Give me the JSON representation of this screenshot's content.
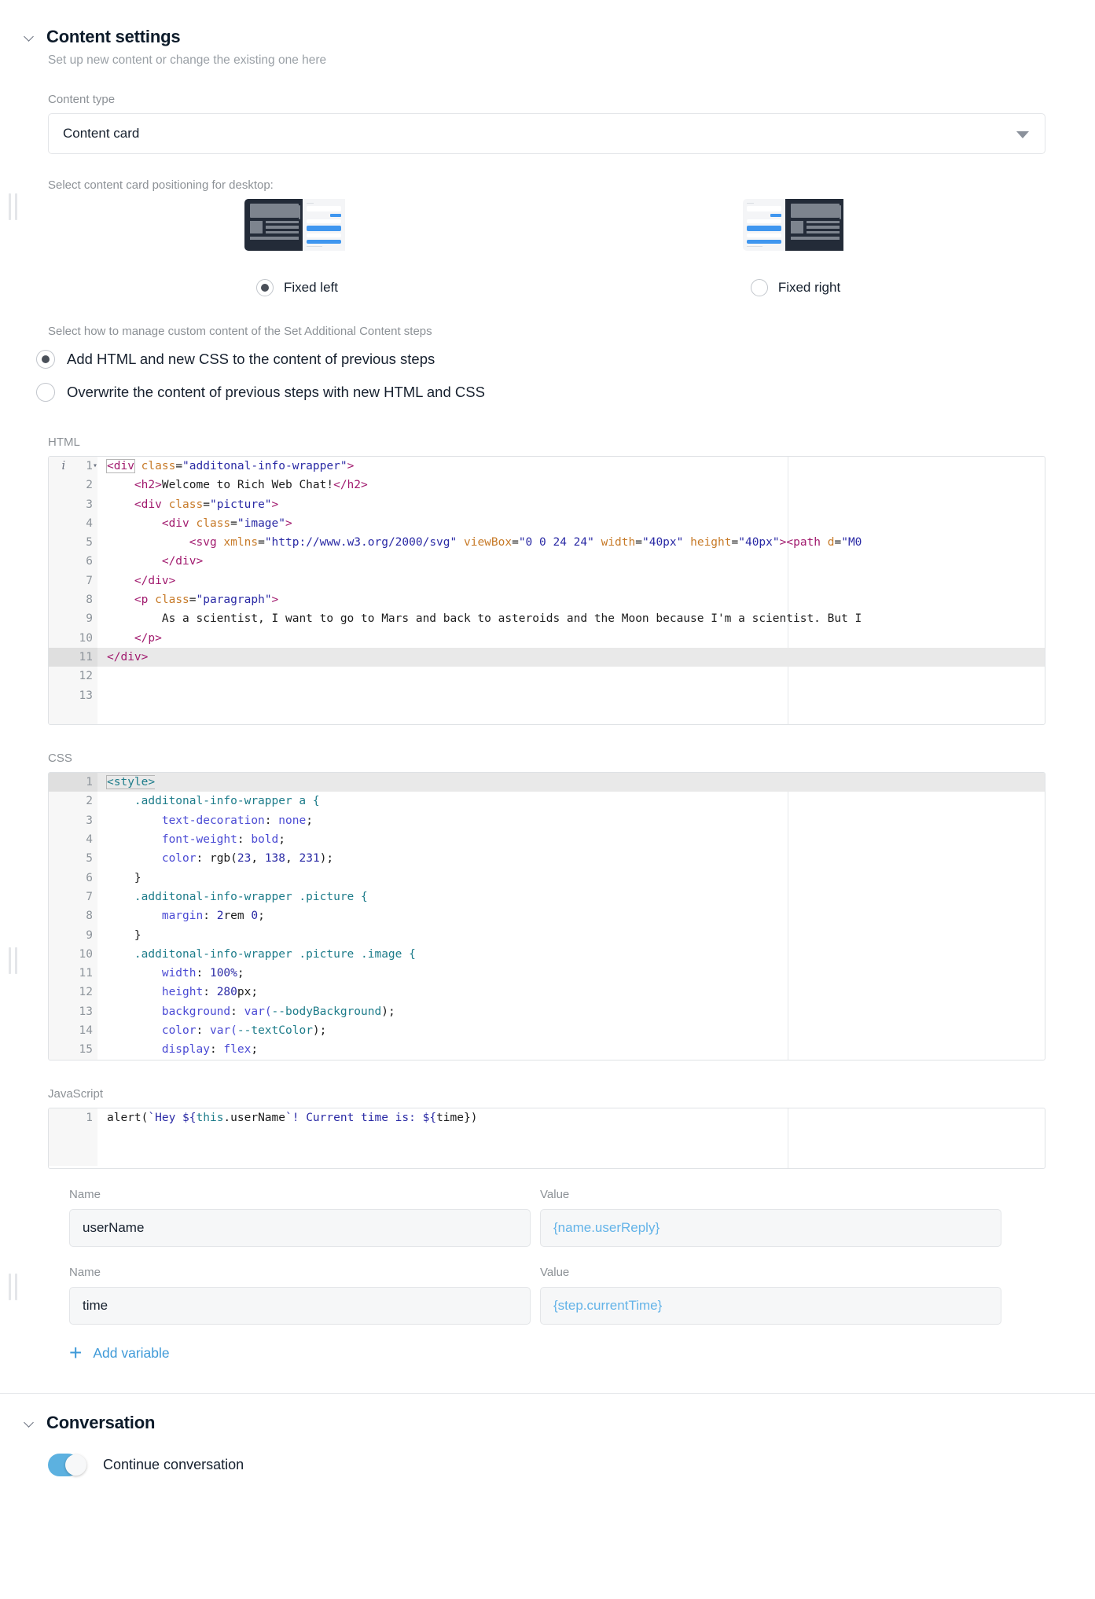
{
  "content_settings": {
    "title": "Content settings",
    "subtitle": "Set up new content or change the existing one here",
    "content_type": {
      "label": "Content type",
      "value": "Content card",
      "options": [
        "Content card"
      ]
    },
    "positioning": {
      "label": "Select content card positioning for desktop:",
      "options": [
        {
          "label": "Fixed left",
          "selected": true
        },
        {
          "label": "Fixed right",
          "selected": false
        }
      ]
    },
    "manage": {
      "label": "Select how to manage custom content of the Set Additional Content steps",
      "options": [
        {
          "label": "Add HTML and new CSS to the content of previous steps",
          "selected": true
        },
        {
          "label": "Overwrite the content of previous steps with new HTML and CSS",
          "selected": false
        }
      ]
    },
    "html_editor": {
      "label": "HTML",
      "active_line": 11,
      "lines": [
        {
          "n": "1",
          "fold": true
        },
        {
          "n": "2",
          "fold": false
        },
        {
          "n": "3",
          "fold": true
        },
        {
          "n": "4",
          "fold": true
        },
        {
          "n": "5",
          "fold": false
        },
        {
          "n": "6",
          "fold": false
        },
        {
          "n": "7",
          "fold": false
        },
        {
          "n": "8",
          "fold": true
        },
        {
          "n": "9",
          "fold": false
        },
        {
          "n": "10",
          "fold": false
        },
        {
          "n": "11",
          "fold": false
        },
        {
          "n": "12",
          "fold": false
        },
        {
          "n": "13",
          "fold": false
        }
      ],
      "code": [
        "<div class=\"additonal-info-wrapper\">",
        "    <h2>Welcome to Rich Web Chat!</h2>",
        "    <div class=\"picture\">",
        "        <div class=\"image\">",
        "            <svg xmlns=\"http://www.w3.org/2000/svg\" viewBox=\"0 0 24 24\" width=\"40px\" height=\"40px\"><path d=\"M0",
        "        </div>",
        "    </div>",
        "    <p class=\"paragraph\">",
        "        As a scientist, I want to go to Mars and back to asteroids and the Moon because I'm a scientist. But I",
        "    </p>",
        "</div>",
        "",
        ""
      ]
    },
    "css_editor": {
      "label": "CSS",
      "active_line": 1,
      "lines": [
        {
          "n": "1",
          "fold": false
        },
        {
          "n": "2",
          "fold": true
        },
        {
          "n": "3",
          "fold": false
        },
        {
          "n": "4",
          "fold": false
        },
        {
          "n": "5",
          "fold": false
        },
        {
          "n": "6",
          "fold": false
        },
        {
          "n": "7",
          "fold": true
        },
        {
          "n": "8",
          "fold": false
        },
        {
          "n": "9",
          "fold": false
        },
        {
          "n": "10",
          "fold": true
        },
        {
          "n": "11",
          "fold": false
        },
        {
          "n": "12",
          "fold": false
        },
        {
          "n": "13",
          "fold": false
        },
        {
          "n": "14",
          "fold": false
        },
        {
          "n": "15",
          "fold": false
        }
      ],
      "code": [
        "<style>",
        "    .additonal-info-wrapper a {",
        "        text-decoration: none;",
        "        font-weight: bold;",
        "        color: rgb(23, 138, 231);",
        "    }",
        "    .additonal-info-wrapper .picture {",
        "        margin: 2rem 0;",
        "    }",
        "    .additonal-info-wrapper .picture .image {",
        "        width: 100%;",
        "        height: 280px;",
        "        background: var(--bodyBackground);",
        "        color: var(--textColor);",
        "        display: flex;"
      ]
    },
    "js_editor": {
      "label": "JavaScript",
      "lines": [
        {
          "n": "1",
          "fold": false
        }
      ],
      "code": [
        "alert(`Hey ${this.userName`! Current time is: ${time})"
      ]
    },
    "variables": [
      {
        "name_label": "Name",
        "name_value": "userName",
        "value_label": "Value",
        "value_placeholder": "{name.userReply}"
      },
      {
        "name_label": "Name",
        "name_value": "time",
        "value_label": "Value",
        "value_placeholder": "{step.currentTime}"
      }
    ],
    "add_variable_label": "Add variable"
  },
  "conversation": {
    "title": "Conversation",
    "toggle_label": "Continue conversation",
    "toggle_on": true
  },
  "colors": {
    "accent_blue": "#3f9ad8",
    "toggle_blue": "#5cb1e0",
    "thumb_dark": "#232b38",
    "thumb_blue": "#3f96ef",
    "placeholder_blue": "#63b3e8"
  }
}
